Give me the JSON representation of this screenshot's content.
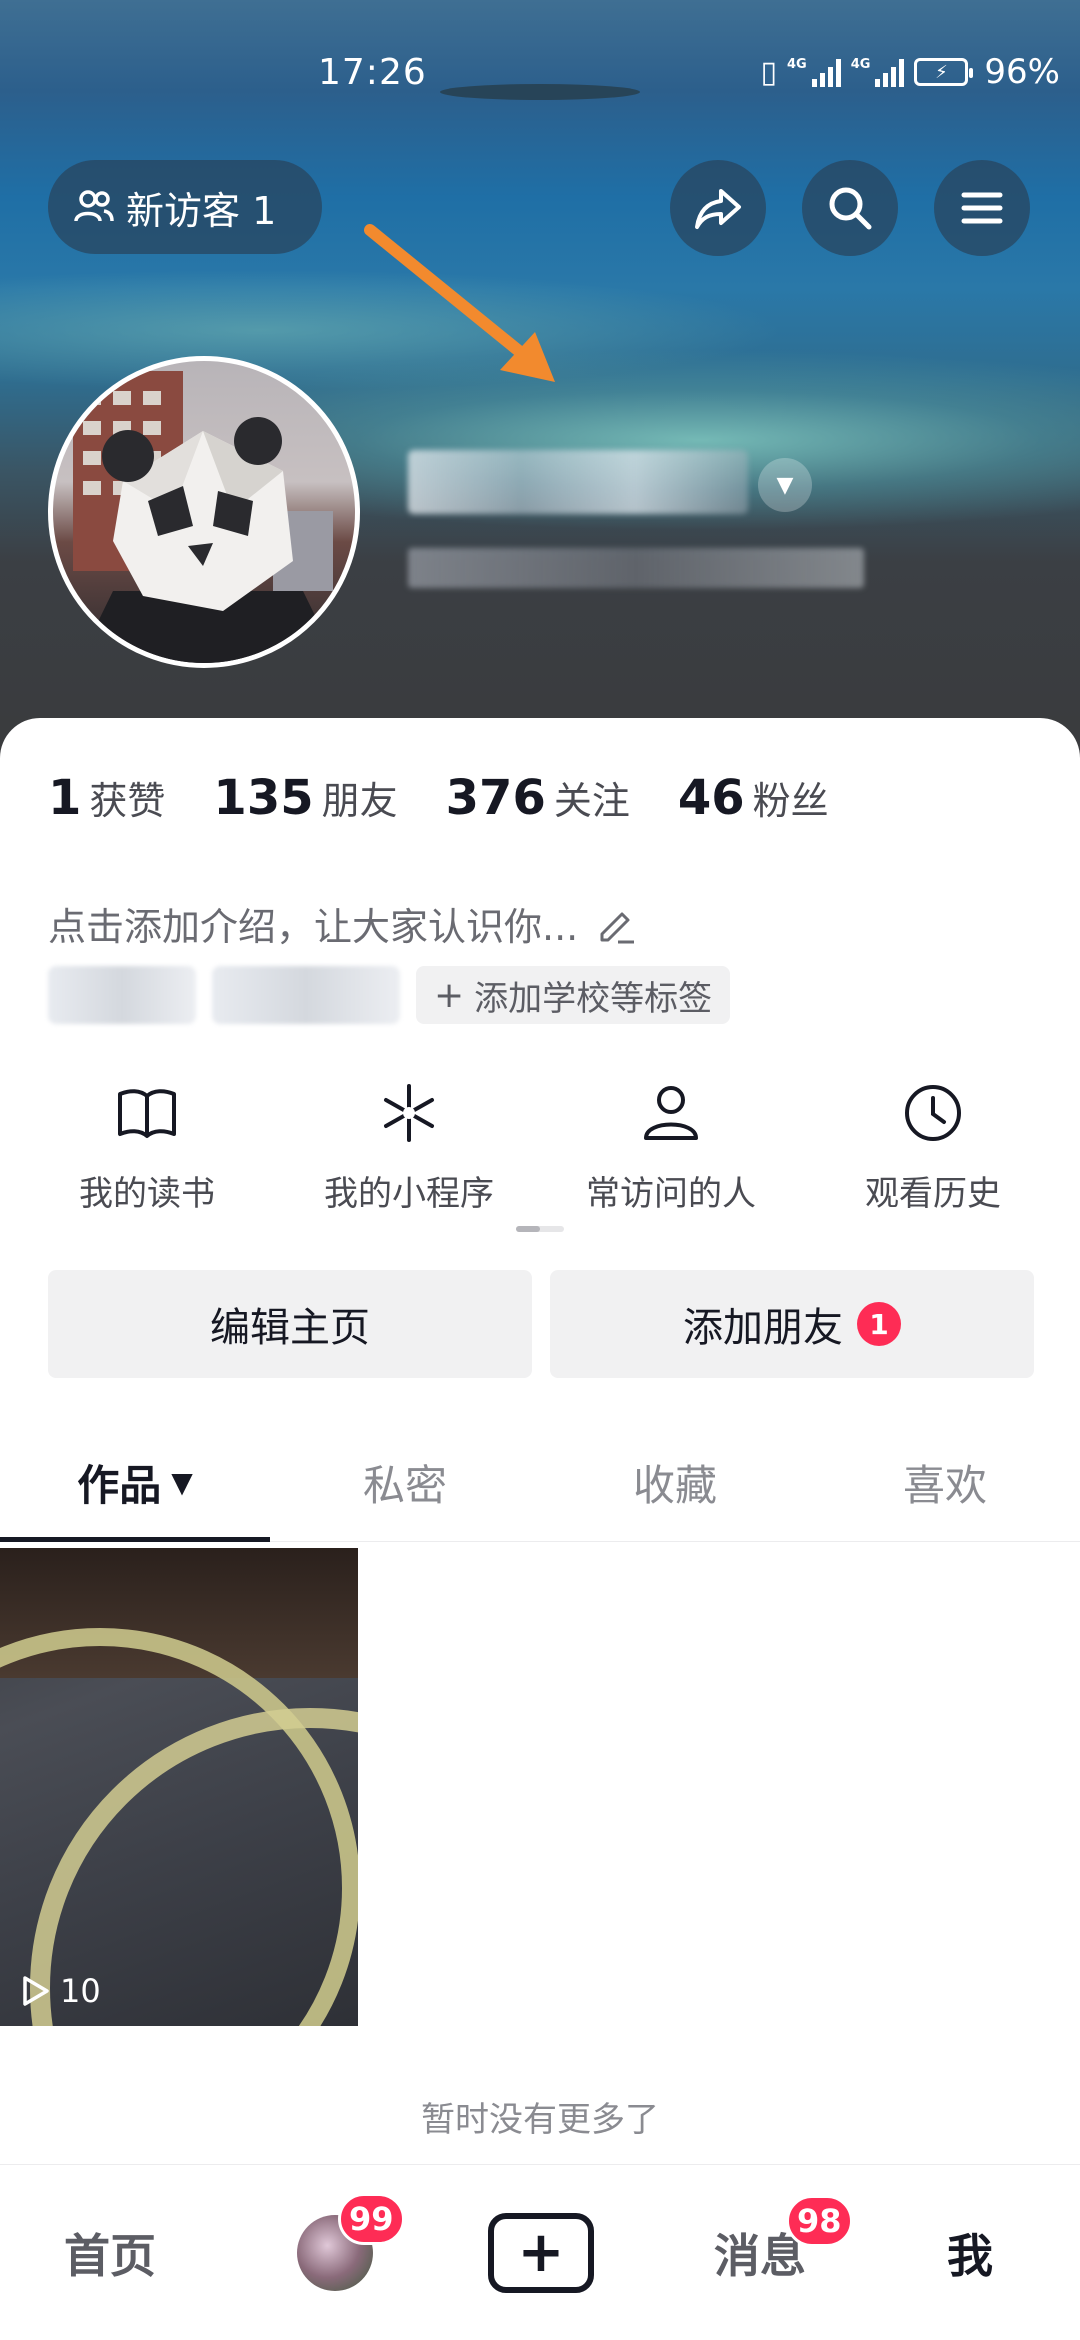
{
  "status_bar": {
    "time": "17:26",
    "network1": "4G",
    "network2": "4G",
    "battery": "96%"
  },
  "header": {
    "visitor_label": "新访客 1"
  },
  "stats": [
    {
      "num": "1",
      "label": "获赞"
    },
    {
      "num": "135",
      "label": "朋友"
    },
    {
      "num": "376",
      "label": "关注"
    },
    {
      "num": "46",
      "label": "粉丝"
    }
  ],
  "bio": {
    "placeholder": "点击添加介绍，让大家认识你..."
  },
  "tags": {
    "add_label": "添加学校等标签"
  },
  "shortcuts": [
    {
      "label": "我的读书",
      "icon": "book-icon"
    },
    {
      "label": "我的小程序",
      "icon": "mini-program-icon"
    },
    {
      "label": "常访问的人",
      "icon": "person-icon"
    },
    {
      "label": "观看历史",
      "icon": "clock-icon"
    }
  ],
  "actions": {
    "edit_label": "编辑主页",
    "add_friend_label": "添加朋友",
    "add_friend_badge": "1"
  },
  "tabs": [
    {
      "label": "作品",
      "active": true
    },
    {
      "label": "私密",
      "active": false
    },
    {
      "label": "收藏",
      "active": false
    },
    {
      "label": "喜欢",
      "active": false
    }
  ],
  "videos": [
    {
      "play_count": "10"
    }
  ],
  "list_footer": "暂时没有更多了",
  "bottom_nav": {
    "home": "首页",
    "friends_badge": "99",
    "messages": "消息",
    "messages_badge": "98",
    "me": "我"
  },
  "colors": {
    "accent_red": "#fe2c55",
    "annotation_arrow": "#f28a2e"
  }
}
